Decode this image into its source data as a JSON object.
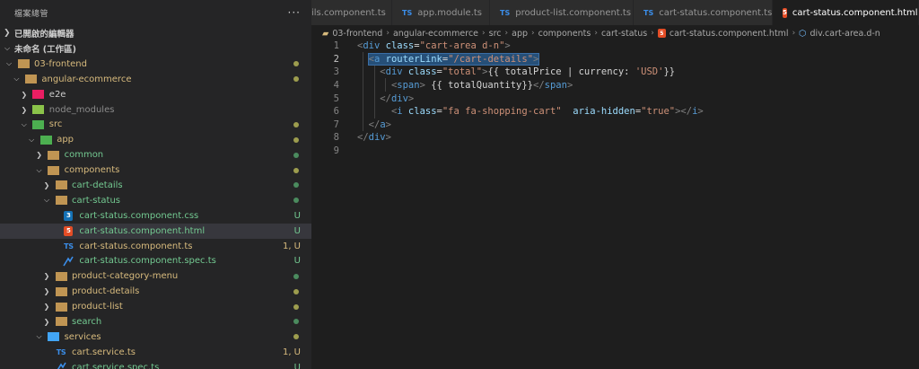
{
  "sidebar": {
    "title": "檔案總管",
    "more": "···",
    "open_editors": "已開啟的編輯器",
    "workspace": "未命名 (工作區)",
    "tree": [
      {
        "label": "03-frontend",
        "icon": "folder-open-icon",
        "color": "#d7ba7d",
        "dot": "#9d9d4e"
      },
      {
        "label": "angular-ecommerce",
        "icon": "folder-open-icon",
        "color": "#d7ba7d",
        "dot": "#9d9d4e"
      },
      {
        "label": "e2e",
        "icon": "folder-e2e-icon",
        "color": "#cccccc",
        "dot": ""
      },
      {
        "label": "node_modules",
        "icon": "folder-node-icon",
        "color": "#8b8b8b",
        "dot": ""
      },
      {
        "label": "src",
        "icon": "folder-src-icon",
        "color": "#d7ba7d",
        "dot": "#9d9d4e"
      },
      {
        "label": "app",
        "icon": "folder-app-icon",
        "color": "#d7ba7d",
        "dot": "#9d9d4e"
      },
      {
        "label": "common",
        "icon": "folder-icon",
        "color": "#73c991",
        "dot": "#4b8b5e"
      },
      {
        "label": "components",
        "icon": "folder-open-icon",
        "color": "#d7ba7d",
        "dot": "#9d9d4e"
      },
      {
        "label": "cart-details",
        "icon": "folder-icon",
        "color": "#73c991",
        "dot": "#4b8b5e"
      },
      {
        "label": "cart-status",
        "icon": "folder-open-icon",
        "color": "#73c991",
        "dot": "#4b8b5e"
      },
      {
        "label": "cart-status.component.css",
        "icon": "css-file-icon",
        "color": "#73c991",
        "deco": "U"
      },
      {
        "label": "cart-status.component.html",
        "icon": "html-file-icon",
        "color": "#73c991",
        "deco": "U"
      },
      {
        "label": "cart-status.component.ts",
        "icon": "ts-file-icon",
        "color": "#d7ba7d",
        "deco": "1, U"
      },
      {
        "label": "cart-status.component.spec.ts",
        "icon": "spec-file-icon",
        "color": "#73c991",
        "deco": "U"
      },
      {
        "label": "product-category-menu",
        "icon": "folder-icon",
        "color": "#d7ba7d",
        "dot": "#4b8b5e"
      },
      {
        "label": "product-details",
        "icon": "folder-icon",
        "color": "#d7ba7d",
        "dot": "#9d9d4e"
      },
      {
        "label": "product-list",
        "icon": "folder-icon",
        "color": "#d7ba7d",
        "dot": "#9d9d4e"
      },
      {
        "label": "search",
        "icon": "folder-icon",
        "color": "#73c991",
        "dot": "#4b8b5e"
      },
      {
        "label": "services",
        "icon": "folder-services-icon",
        "color": "#d7ba7d",
        "dot": "#9d9d4e"
      },
      {
        "label": "cart.service.ts",
        "icon": "ts-file-icon",
        "color": "#d7ba7d",
        "deco": "1, U"
      },
      {
        "label": "cart.service.spec.ts",
        "icon": "spec-file-icon",
        "color": "#73c991",
        "deco": "U"
      }
    ]
  },
  "tabs": [
    {
      "label": "ils.component.ts",
      "icon": "",
      "active": false
    },
    {
      "label": "app.module.ts",
      "icon": "TS",
      "active": false
    },
    {
      "label": "product-list.component.ts",
      "icon": "TS",
      "active": false
    },
    {
      "label": "cart-status.component.ts",
      "icon": "TS",
      "active": false
    },
    {
      "label": "cart-status.component.html",
      "icon": "html-file-icon",
      "active": true
    }
  ],
  "tab_close": "×",
  "breadcrumb": [
    "03-frontend",
    "angular-ecommerce",
    "src",
    "app",
    "components",
    "cart-status",
    "cart-status.component.html",
    "div.cart-area.d-n"
  ],
  "code": {
    "line_numbers": [
      "1",
      "2",
      "3",
      "4",
      "5",
      "6",
      "7",
      "8",
      "9"
    ],
    "lines": [
      "<div class=\"cart-area d-n\">",
      "  <a routerLink=\"/cart-details\">",
      "    <div class=\"total\">{{ totalPrice | currency: 'USD'}}",
      "      <span> {{ totalQuantity}}</span>",
      "    </div>",
      "      <i class=\"fa fa-shopping-cart\"  aria-hidden=\"true\"></i>",
      "  </a>",
      "</div>",
      ""
    ]
  },
  "colors": {
    "modified": "#d7ba7d",
    "untracked": "#73c991",
    "html_icon": "#e44d26",
    "css_icon": "#1572b6",
    "ts_icon": "#3b8eea"
  }
}
